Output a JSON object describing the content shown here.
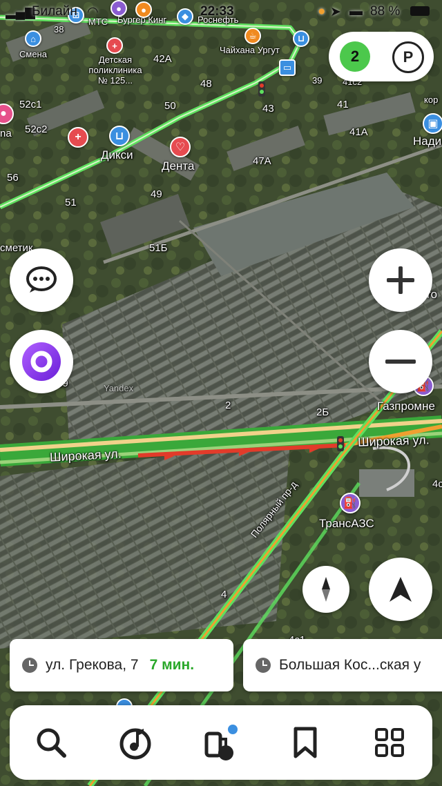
{
  "status_bar": {
    "carrier": "Билайн",
    "time": "22:33",
    "battery_percent": "88 %"
  },
  "map": {
    "labels": {
      "n38": "38",
      "mts": "МТС",
      "burger": "Бургер Кинг",
      "rosneft": "Роснефть",
      "smena": "Смена",
      "polyclinic": "Детская поликлиника № 125...",
      "n42a": "42А",
      "chaikhana": "Чайхана Ургут",
      "n39": "39",
      "n41c2": "41с2",
      "kor": "кор",
      "n52c1": "52с1",
      "n48": "48",
      "n50": "50",
      "n43": "43",
      "n41": "41",
      "na": "na",
      "n52c2": "52с2",
      "n41a": "41А",
      "nadi": "Нади",
      "diksi": "Дикси",
      "denta": "Дента",
      "n47a": "47А",
      "n56": "56",
      "n49": "49",
      "n51": "51",
      "n51b": "51Б",
      "smetik": "сметик",
      "avto": "Авто",
      "b59": "в 59",
      "n2": "2",
      "n2b": "2Б",
      "gazprom": "Газпромне",
      "shirokaya_left": "Широкая ул.",
      "shirokaya_right": "Широкая ул.",
      "polyarny": "Полярный пр-д",
      "n4c": "4с",
      "transazs": "ТрансАЗС",
      "n4": "4",
      "n4c1": "4с1",
      "yandex": "Yandex"
    },
    "traffic_score": "2"
  },
  "colors": {
    "route_green": "#5ee05e",
    "route_red": "#e23b2a",
    "route_orange": "#f0a030",
    "eta_green": "#2aa82a",
    "alice_purple": "#8a2be2",
    "poi_red": "#e64b50",
    "poi_blue": "#3b8fe0"
  },
  "route_chips": [
    {
      "address": "ул. Грекова, 7",
      "eta": "7 мин."
    },
    {
      "address": "Большая Кос...ская у",
      "eta": ""
    }
  ],
  "bottom_tabs": [
    {
      "icon": "search-icon"
    },
    {
      "icon": "music-icon"
    },
    {
      "icon": "fuel-icon"
    },
    {
      "icon": "bookmark-icon"
    },
    {
      "icon": "grid-menu-icon"
    }
  ]
}
